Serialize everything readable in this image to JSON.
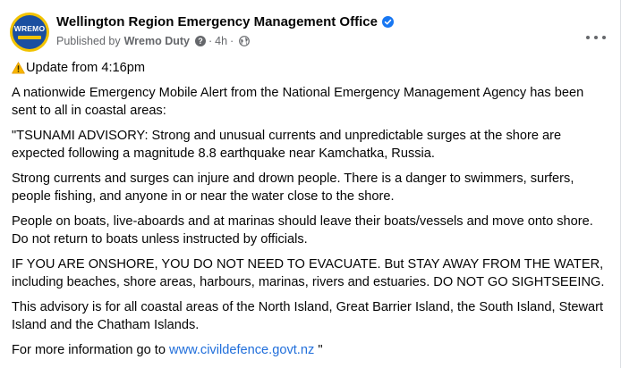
{
  "post": {
    "page_name": "Wellington Region Emergency Management Office",
    "avatar_text": "WREMO",
    "published_prefix": "Published by",
    "publisher": "Wremo Duty",
    "help_icon": "question-circle-icon",
    "separator": "·",
    "time": "4h",
    "audience_icon": "globe-icon",
    "more_icon": "more-horizontal-icon",
    "verified_icon": "verified-badge-icon",
    "warning_icon": "warning-triangle-icon",
    "colors": {
      "verified": "#1877f2",
      "link": "#216fdb",
      "meta": "#65676b",
      "avatar_yellow": "#f2c300",
      "avatar_blue": "#1a4fa0"
    }
  },
  "content": {
    "update": "Update from 4:16pm",
    "p1": "A nationwide Emergency Mobile Alert from the National Emergency Management Agency has been sent to all in coastal areas:",
    "p2": "\"TSUNAMI ADVISORY: Strong and unusual currents and unpredictable surges at the shore are expected following a magnitude 8.8 earthquake near Kamchatka, Russia.",
    "p3": "Strong currents and surges can injure and drown people. There is a danger to swimmers, surfers, people fishing, and anyone in or near the water close to the shore.",
    "p4": "People on boats, live-aboards and at marinas should leave their boats/vessels and move onto shore. Do not return to boats unless instructed by officials.",
    "p5": "IF YOU ARE ONSHORE, YOU DO NOT NEED TO EVACUATE. But STAY AWAY FROM THE WATER, including beaches, shore areas, harbours, marinas, rivers and estuaries. DO NOT GO SIGHTSEEING.",
    "p6": "This advisory is for all coastal areas of the North Island, Great Barrier Island, the South Island, Stewart Island and the Chatham Islands.",
    "p7_prefix": "For more information go to",
    "p7_link": "www.civildefence.govt.nz",
    "p7_suffix": " \""
  }
}
